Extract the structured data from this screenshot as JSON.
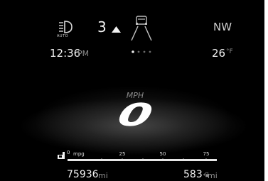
{
  "headlights": {
    "mode_label": "AUTO",
    "icon": "auto-headlight-icon"
  },
  "gear": {
    "value": "3",
    "icon": "shift-up-arrow-icon"
  },
  "lane": {
    "icon": "lane-assist-car-icon"
  },
  "compass": {
    "heading": "NW"
  },
  "clock": {
    "time": "12:36",
    "ampm": "PM"
  },
  "pager": {
    "dot_count": 4,
    "active_index": 0
  },
  "temperature": {
    "value": "26",
    "unit": "°F"
  },
  "speed": {
    "unit": "MPH",
    "value": "0"
  },
  "fuel_economy": {
    "unit": "mpg",
    "scale_labels": [
      "0",
      "25",
      "50",
      "75"
    ],
    "scale_min": 0,
    "scale_max": 75,
    "current_value": 0,
    "icon": "fuel-economy-icon"
  },
  "odometer": {
    "value": "75936",
    "unit": "mi"
  },
  "range": {
    "value": "583",
    "unit": "mi",
    "icon": "fuel-pump-icon"
  },
  "colors": {
    "background": "#000000",
    "text_primary": "#f2f2f2",
    "text_secondary": "#8d8d8d",
    "bar_fill": "#e6e6e6"
  }
}
